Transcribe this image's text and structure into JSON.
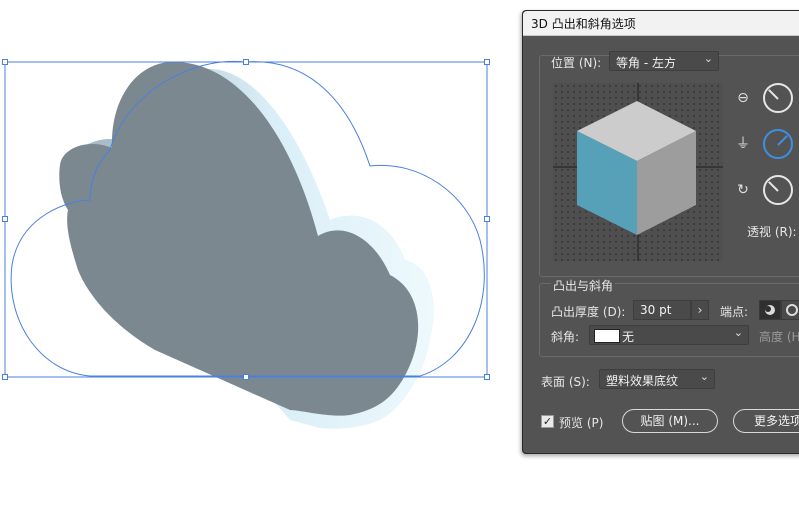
{
  "dialog": {
    "title": "3D 凸出和斜角选项",
    "position": {
      "label": "位置 (N):",
      "value": "等角 - 左方"
    },
    "perspective_label": "透视 (R):",
    "extrude_section": {
      "title": "凸出与斜角",
      "depth_label": "凸出厚度 (D):",
      "depth_value": "30 pt",
      "cap_label": "端点:",
      "bevel_label": "斜角:",
      "bevel_value": "无",
      "height_label": "高度 (H"
    },
    "surface": {
      "label": "表面 (S):",
      "value": "塑料效果底纹"
    },
    "preview_label": "预览 (P)",
    "preview_checked": true,
    "map_button": "贴图 (M)...",
    "more_options_button": "更多选项"
  },
  "colors": {
    "dialog_bg": "#535353",
    "accent": "#3f8fe0",
    "cloud_front": "#7b8890",
    "cube_top": "#cccccc",
    "cube_left": "#57a1b8",
    "cube_right": "#9d9d9d",
    "selection": "#4a7fe0"
  },
  "icons": [
    "axis-x-icon",
    "axis-y-icon",
    "axis-z-icon",
    "chevron-down-icon",
    "chevron-right-icon",
    "checkmark-icon"
  ]
}
